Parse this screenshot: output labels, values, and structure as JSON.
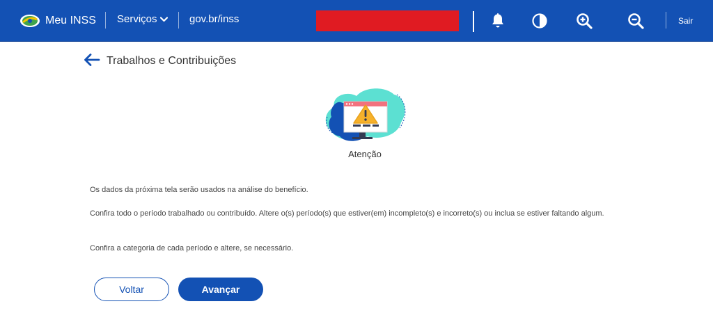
{
  "header": {
    "brand": "Meu INSS",
    "services": "Serviços",
    "gov_link": "gov.br/inss",
    "logout": "Sair",
    "icons": [
      "bell-icon",
      "contrast-icon",
      "zoom-in-icon",
      "zoom-out-icon"
    ]
  },
  "page": {
    "title": "Trabalhos e Contribuições",
    "attention_label": "Atenção"
  },
  "messages": [
    "Os dados da próxima tela serão usados na análise do benefício.",
    "Confira todo o período trabalhado ou contribuído. Altere o(s) período(s) que estiver(em) incompleto(s) e incorreto(s) ou inclua se estiver faltando algum.",
    "Confira a categoria de cada período e altere, se necessário."
  ],
  "actions": {
    "back_label": "Voltar",
    "next_label": "Avançar"
  },
  "colors": {
    "primary": "#1351b4",
    "header_bg": "#1351b4",
    "redaction": "#e01b22"
  }
}
